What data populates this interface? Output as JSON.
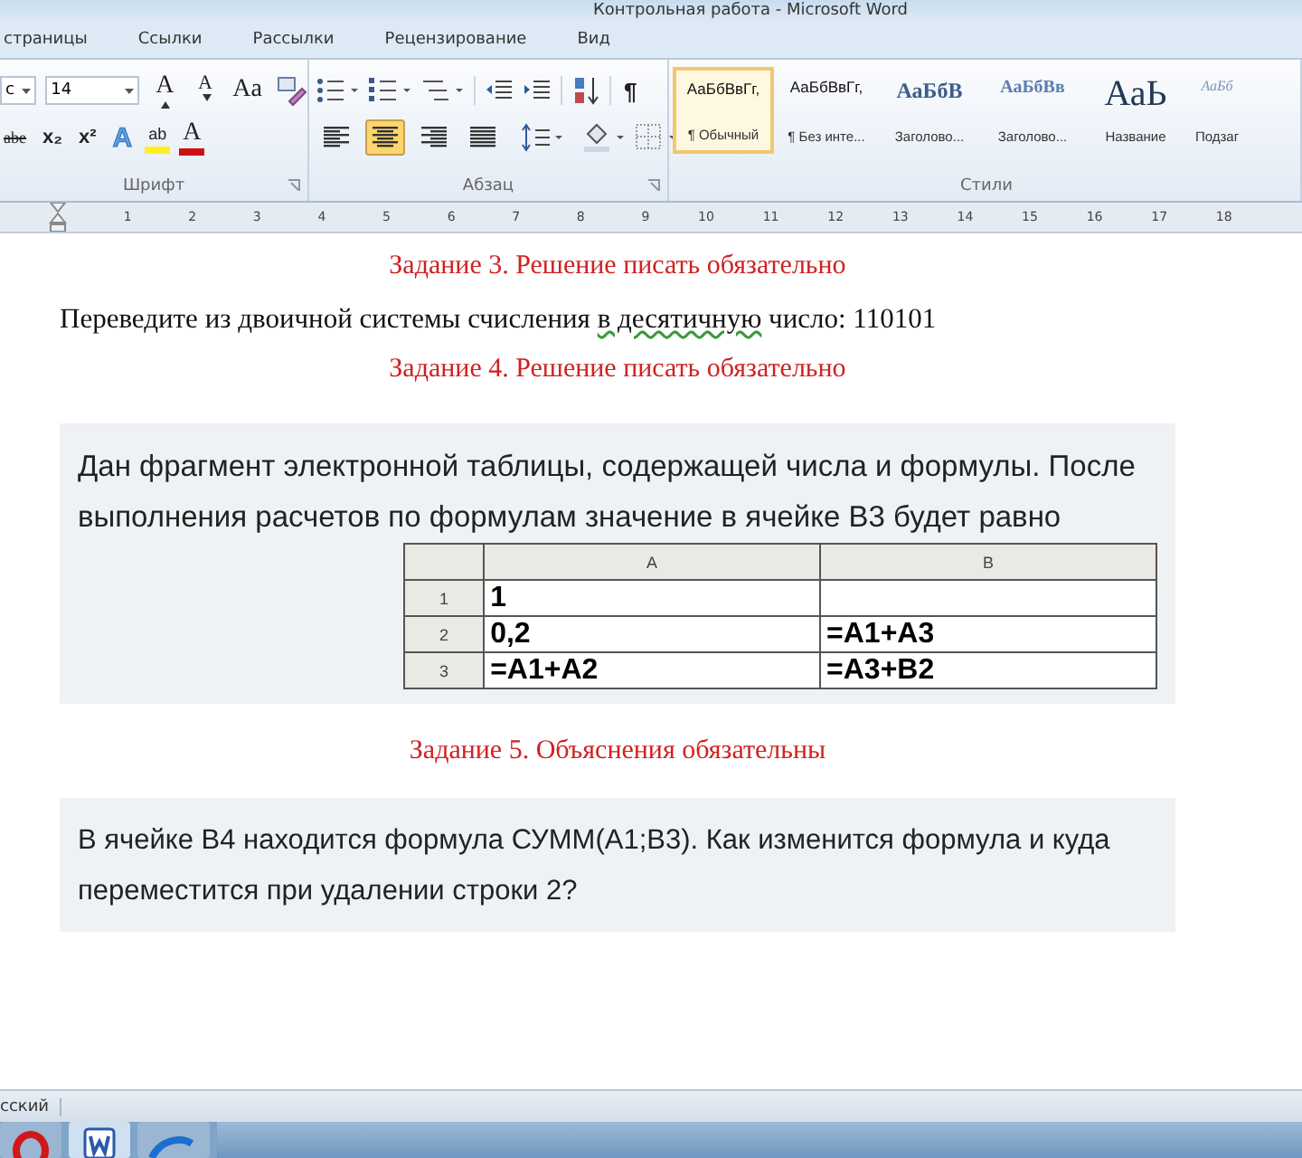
{
  "window": {
    "title": "Контрольная работа - Microsoft Word"
  },
  "tabs": [
    {
      "label": "страницы",
      "selected": false
    },
    {
      "label": "Ссылки",
      "selected": false
    },
    {
      "label": "Рассылки",
      "selected": false
    },
    {
      "label": "Рецензирование",
      "selected": false
    },
    {
      "label": "Вид",
      "selected": false
    }
  ],
  "font_group": {
    "label": "Шрифт",
    "font_name": "c",
    "font_size": "14",
    "row1": [
      {
        "kind": "grow",
        "label": "A"
      },
      {
        "kind": "shrink",
        "label": "A"
      },
      {
        "kind": "case",
        "label": "Aa"
      },
      {
        "kind": "clear"
      }
    ],
    "row2": [
      {
        "kind": "strike",
        "label": "abe"
      },
      {
        "kind": "sub",
        "label": "x₂"
      },
      {
        "kind": "sup",
        "label": "x²"
      },
      {
        "kind": "effects",
        "label": "A"
      },
      {
        "kind": "highlight",
        "label": "ab"
      },
      {
        "kind": "color",
        "label": "A"
      }
    ]
  },
  "paragraph_group": {
    "label": "Абзац",
    "show_marks": "¶",
    "alignment": [
      {
        "kind": "left",
        "selected": false
      },
      {
        "kind": "center",
        "selected": true
      },
      {
        "kind": "right",
        "selected": false
      },
      {
        "kind": "justify",
        "selected": false
      }
    ]
  },
  "styles_group": {
    "label": "Стили",
    "styles": [
      {
        "sample": "АаБбВвГг,",
        "name": "¶ Обычный",
        "kind": "normal",
        "selected": true
      },
      {
        "sample": "АаБбВвГг,",
        "name": "¶ Без инте...",
        "kind": "normal",
        "selected": false
      },
      {
        "sample": "АаБбВ",
        "name": "Заголово...",
        "kind": "heading1",
        "selected": false
      },
      {
        "sample": "АаБбВв",
        "name": "Заголово...",
        "kind": "heading2",
        "selected": false
      },
      {
        "sample": "АаЬ",
        "name": "Название",
        "kind": "title",
        "selected": false
      },
      {
        "sample": "АаБб",
        "name": "Подзаг",
        "kind": "subtitle",
        "selected": false
      }
    ]
  },
  "ruler": {
    "marks": [
      "1",
      "2",
      "3",
      "4",
      "5",
      "6",
      "7",
      "8",
      "9",
      "10",
      "11",
      "12",
      "13",
      "14",
      "15",
      "16",
      "17",
      "18"
    ]
  },
  "document": [
    {
      "kind": "heading",
      "text": "Задание 3. Решение писать обязательно"
    },
    {
      "kind": "paragraph",
      "segments": [
        {
          "text": "Переведите из двоичной системы счисления ",
          "flagged": false
        },
        {
          "text": "в десятичную",
          "flagged": true
        },
        {
          "text": " число: 110101",
          "flagged": false
        }
      ]
    },
    {
      "kind": "heading",
      "text": "Задание 4. Решение писать обязательно"
    },
    {
      "kind": "panel",
      "text": "Дан фрагмент электронной таблицы, содержащей числа и формулы. После выполнения расчетов по формулам значение в ячейке В3 будет равно",
      "table": {
        "columns": [
          "A",
          "B"
        ],
        "rows": [
          {
            "number": "1",
            "cells": [
              "1",
              ""
            ]
          },
          {
            "number": "2",
            "cells": [
              "0,2",
              "=A1+A3"
            ]
          },
          {
            "number": "3",
            "cells": [
              "=A1+A2",
              "=A3+B2"
            ]
          }
        ]
      }
    },
    {
      "kind": "heading",
      "text": "Задание 5. Объяснения обязательны"
    },
    {
      "kind": "panel",
      "text": "В ячейке В4 находится формула СУММ(А1;В3). Как изменится формула и куда переместится при удалении строки 2?"
    }
  ],
  "status_bar": {
    "language": "сский"
  },
  "taskbar": [
    {
      "kind": "opera",
      "selected": false
    },
    {
      "kind": "word",
      "selected": true
    },
    {
      "kind": "ie",
      "selected": false
    }
  ]
}
